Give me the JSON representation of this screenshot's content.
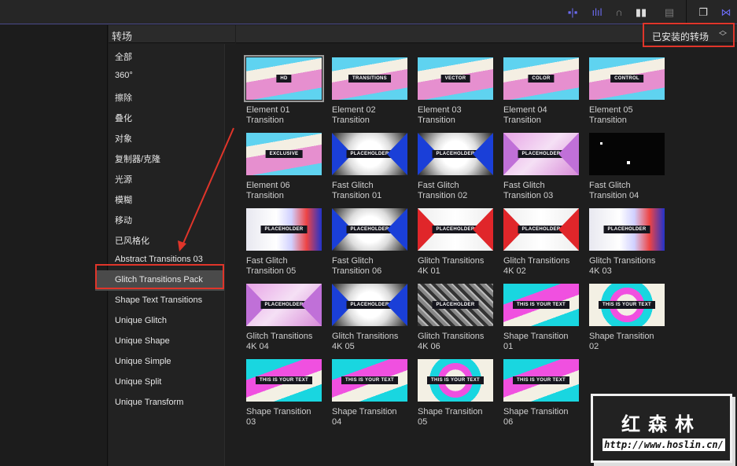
{
  "toolbar": {
    "icons": [
      "audio-video-split-icon",
      "audio-waveform-icon",
      "headphones-icon",
      "video-clip-icon",
      "filmstrip-icon",
      "window-icon",
      "transitions-browser-icon"
    ]
  },
  "sidebar": {
    "header": "转场",
    "selected_index": 11,
    "items": [
      {
        "label": "全部"
      },
      {
        "label": "360°"
      },
      {
        "label": "擦除"
      },
      {
        "label": "叠化"
      },
      {
        "label": "对象"
      },
      {
        "label": "复制器/克隆"
      },
      {
        "label": "光源"
      },
      {
        "label": "模糊"
      },
      {
        "label": "移动"
      },
      {
        "label": "已风格化"
      },
      {
        "label": "Abstract Transitions 03"
      },
      {
        "label": "Glitch Transitions Pack"
      },
      {
        "label": "Shape Text Transitions"
      },
      {
        "label": "Unique Glitch"
      },
      {
        "label": "Unique Shape"
      },
      {
        "label": "Unique Simple"
      },
      {
        "label": "Unique Split"
      },
      {
        "label": "Unique Transform"
      }
    ]
  },
  "filter": {
    "label": "已安装的转场",
    "chevron": "⌃⌄"
  },
  "accent": "#e0352a",
  "grid": [
    {
      "caption": "Element 01\nTransition",
      "tag": "HD",
      "style": "t-pastel",
      "selected": true
    },
    {
      "caption": "Element 02\nTransition",
      "tag": "TRANSITIONS",
      "style": "t-pastel"
    },
    {
      "caption": "Element 03\nTransition",
      "tag": "VECTOR",
      "style": "t-pastel"
    },
    {
      "caption": "Element 04\nTransition",
      "tag": "COLOR",
      "style": "t-pastel"
    },
    {
      "caption": "Element 05\nTransition",
      "tag": "CONTROL",
      "style": "t-pastel"
    },
    {
      "caption": "Element 06\nTransition",
      "tag": "EXCLUSIVE",
      "style": "t-pastel"
    },
    {
      "caption": "Fast Glitch\nTransition 01",
      "tag": "PLACEHOLDER",
      "style": "t-blue"
    },
    {
      "caption": "Fast Glitch\nTransition 02",
      "tag": "PLACEHOLDER",
      "style": "t-blue"
    },
    {
      "caption": "Fast Glitch\nTransition 03",
      "tag": "PLACEHOLDER",
      "style": "t-pink"
    },
    {
      "caption": "Fast Glitch\nTransition 04",
      "tag": "",
      "style": "t-dark"
    },
    {
      "caption": "Fast Glitch\nTransition 05",
      "tag": "PLACEHOLDER",
      "style": "t-mix"
    },
    {
      "caption": "Fast Glitch\nTransition 06",
      "tag": "PLACEHOLDER",
      "style": "t-blue"
    },
    {
      "caption": "Glitch Transitions\n4K 01",
      "tag": "PLACEHOLDER",
      "style": "t-red"
    },
    {
      "caption": "Glitch Transitions\n4K 02",
      "tag": "PLACEHOLDER",
      "style": "t-red"
    },
    {
      "caption": "Glitch Transitions\n4K 03",
      "tag": "PLACEHOLDER",
      "style": "t-mix"
    },
    {
      "caption": "Glitch Transitions\n4K 04",
      "tag": "PLACEHOLDER",
      "style": "t-pink"
    },
    {
      "caption": "Glitch Transitions\n4K 05",
      "tag": "PLACEHOLDER",
      "style": "t-blue"
    },
    {
      "caption": "Glitch Transitions\n4K 06",
      "tag": "PLACEHOLDER",
      "style": "t-glitchdark"
    },
    {
      "caption": "Shape Transition\n01",
      "tag": "THIS IS YOUR TEXT",
      "style": "t-shape2"
    },
    {
      "caption": "Shape Transition\n02",
      "tag": "THIS IS YOUR TEXT",
      "style": "t-shape"
    },
    {
      "caption": "Shape Transition\n03",
      "tag": "THIS IS YOUR TEXT",
      "style": "t-shape2"
    },
    {
      "caption": "Shape Transition\n04",
      "tag": "THIS IS YOUR TEXT",
      "style": "t-shape2"
    },
    {
      "caption": "Shape Transition\n05",
      "tag": "THIS IS YOUR TEXT",
      "style": "t-shape"
    },
    {
      "caption": "Shape Transition\n06",
      "tag": "THIS IS YOUR TEXT",
      "style": "t-shape2"
    }
  ],
  "watermark": {
    "title": "红森林",
    "url": "http://www.hoslin.cn/"
  }
}
